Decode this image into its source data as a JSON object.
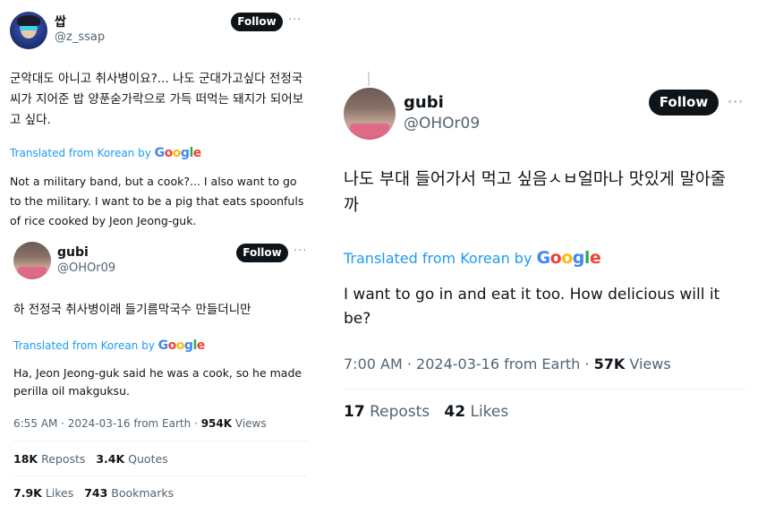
{
  "left": {
    "tweet1": {
      "name": "쌉",
      "handle": "@z_ssap",
      "follow": "Follow",
      "more": "···",
      "text": "군악대도 아니고 취사병이요?... 나도 군대가고싶다 전정국씨가 지어준 밥 양푼숟가락으로 가득 떠먹는 돼지가 되어보고 싶다.",
      "translated_prefix": "Translated from Korean by",
      "translation": "Not a military band, but a cook?... I also want to go to the military. I want to be a pig that eats spoonfuls of rice cooked by Jeon Jeong-guk."
    },
    "tweet2": {
      "name": "gubi",
      "handle": "@OHOr09",
      "follow": "Follow",
      "more": "···",
      "text": "하 전정국 취사병이래 들기름막국수 만들더니만",
      "translated_prefix": "Translated from Korean by",
      "translation": "Ha, Jeon Jeong-guk said he was a cook, so he made perilla oil makguksu.",
      "time": "6:55 AM · 2024-03-16 from Earth ·",
      "views_count": "954K",
      "views_label": "Views",
      "reposts_count": "18K",
      "reposts_label": "Reposts",
      "quotes_count": "3.4K",
      "quotes_label": "Quotes",
      "likes_count": "7.9K",
      "likes_label": "Likes",
      "bookmarks_count": "743",
      "bookmarks_label": "Bookmarks"
    }
  },
  "right": {
    "tweet": {
      "name": "gubi",
      "handle": "@OHOr09",
      "follow": "Follow",
      "more": "···",
      "text": "나도 부대 들어가서 먹고 싶음ㅅㅂ얼마나 맛있게 말아줄까",
      "translated_prefix": "Translated from Korean by",
      "translation": "I want to go in and eat it too. How delicious will it be?",
      "time": "7:00 AM · 2024-03-16 from Earth ·",
      "views_count": "57K",
      "views_label": "Views",
      "reposts_count": "17",
      "reposts_label": "Reposts",
      "likes_count": "42",
      "likes_label": "Likes"
    }
  },
  "google_logo": "Google",
  "colors": {
    "link": "#1d9bf0",
    "text": "#0f1419",
    "secondary": "#536471",
    "button": "#0f1419",
    "divider": "#eff3f4",
    "google_blue": "#4285F4",
    "google_red": "#EA4335",
    "google_yellow": "#FBBC05",
    "google_green": "#34A853"
  }
}
